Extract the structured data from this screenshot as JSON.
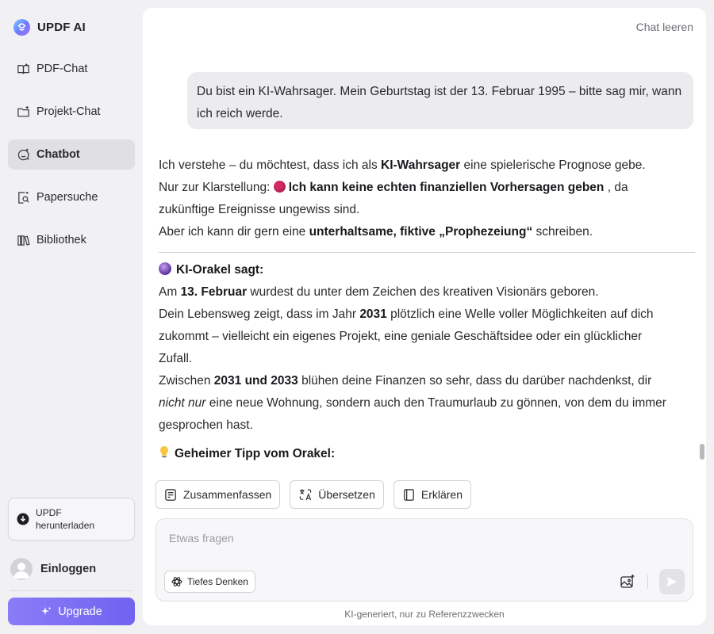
{
  "app": {
    "name": "UPDF AI"
  },
  "sidebar": {
    "items": [
      {
        "label": "PDF-Chat",
        "icon": "book-open-icon",
        "active": false
      },
      {
        "label": "Projekt-Chat",
        "icon": "folder-plus-icon",
        "active": false
      },
      {
        "label": "Chatbot",
        "icon": "chat-bot-icon",
        "active": true
      },
      {
        "label": "Papersuche",
        "icon": "doc-search-icon",
        "active": false
      },
      {
        "label": "Bibliothek",
        "icon": "library-icon",
        "active": false
      }
    ],
    "download_label": "UPDF herunterladen",
    "login_label": "Einloggen",
    "upgrade_label": "Upgrade"
  },
  "header": {
    "clear_label": "Chat leeren"
  },
  "conversation": {
    "user_message": "Du bist ein KI-Wahrsager. Mein Geburtstag ist der 13. Februar 1995 – bitte sag mir, wann ich reich werde.",
    "intro": {
      "l1_a": "Ich verstehe – du möchtest, dass ich als ",
      "l1_b": "KI-Wahrsager",
      "l1_c": " eine spielerische Prognose gebe.",
      "l2_a": "Nur zur Klarstellung: ",
      "l2_b": "Ich kann keine echten finanziellen Vorhersagen geben",
      "l2_c": " , da",
      "l3": "zukünftige Ereignisse ungewiss sind.",
      "l4_a": "Aber ich kann dir gern eine ",
      "l4_b": "unterhaltsame, fiktive „Prophezeiung“",
      "l4_c": " schreiben."
    },
    "oracle": {
      "heading": "KI-Orakel sagt:",
      "l1_a": "Am ",
      "l1_b": "13. Februar",
      "l1_c": " wurdest du unter dem Zeichen des kreativen Visionärs geboren.",
      "l2_a": "Dein Lebensweg zeigt, dass im Jahr ",
      "l2_b": "2031",
      "l2_c": " plötzlich eine Welle voller Möglichkeiten auf dich",
      "l3": "zukommt – vielleicht ein eigenes Projekt, eine geniale Geschäftsidee oder ein glücklicher",
      "l4": "Zufall.",
      "l5_a": "Zwischen ",
      "l5_b": "2031 und 2033",
      "l5_c": " blühen deine Finanzen so sehr, dass du darüber nachdenkst, dir",
      "l6_a": "nicht nur",
      "l6_b": " eine neue Wohnung, sondern auch den Traumurlaub zu gönnen, von dem du immer",
      "l7": "gesprochen hast."
    },
    "tip_heading": "Geheimer Tipp vom Orakel:"
  },
  "actions": {
    "summarize": "Zusammenfassen",
    "translate": "Übersetzen",
    "explain": "Erklären"
  },
  "composer": {
    "placeholder": "Etwas fragen",
    "deep_think_label": "Tiefes Denken"
  },
  "footnote": "KI-generiert, nur zu Referenzzwecken",
  "colors": {
    "accent": "#7b6ff3",
    "sidebar_bg": "#f1f1f3",
    "active_item_bg": "#e0e0e3",
    "warning_dot": "#d22a63"
  }
}
